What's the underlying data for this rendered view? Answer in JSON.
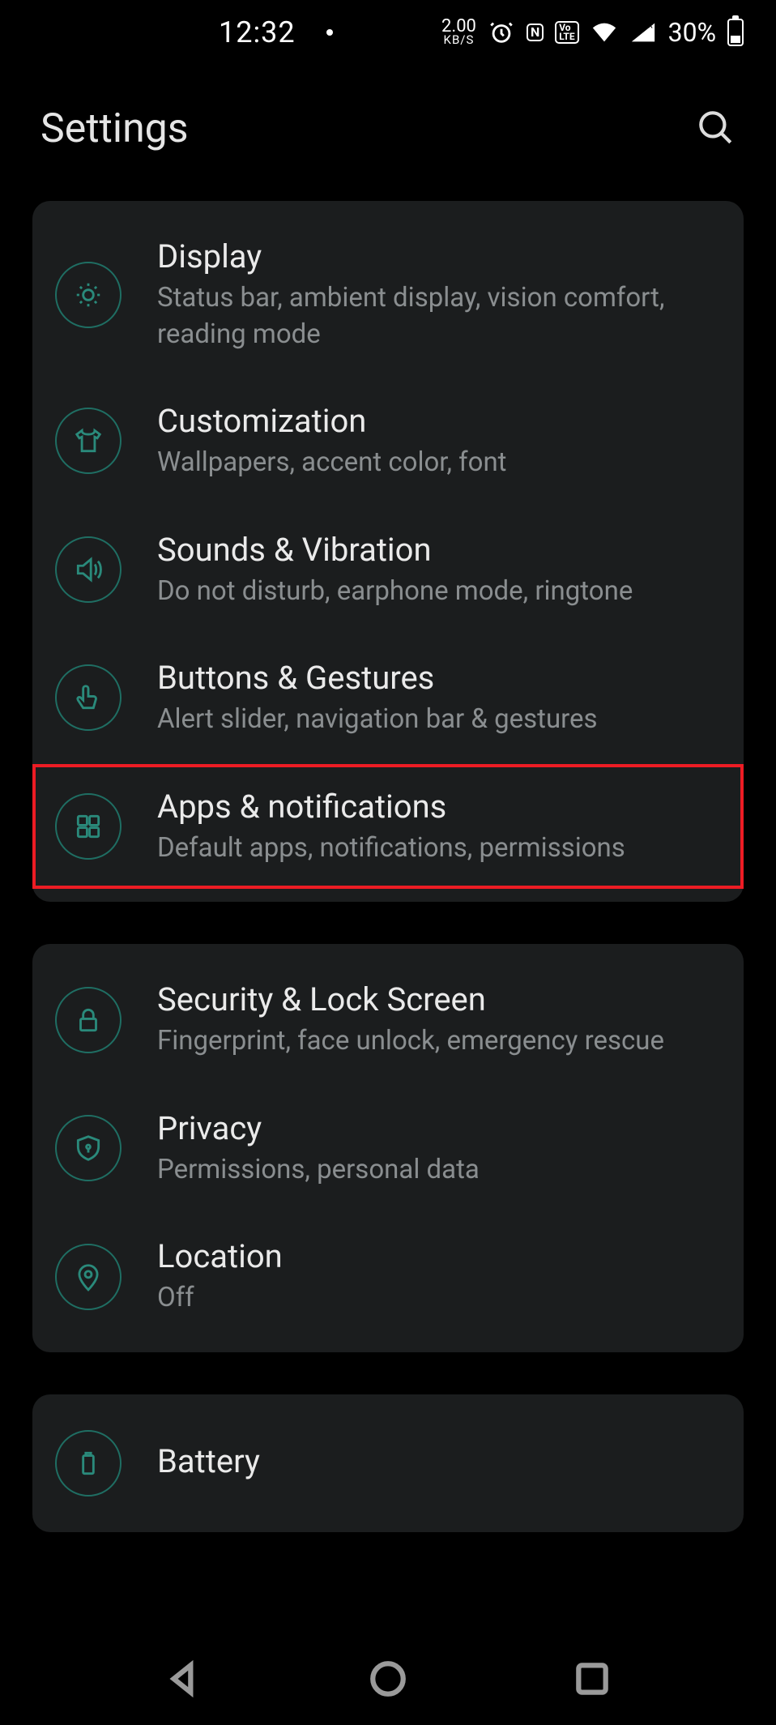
{
  "status": {
    "time": "12:32",
    "speed_top": "2.00",
    "speed_bot": "KB/S",
    "nfc": "N",
    "volte": "Vo LTE",
    "battery_pct": "30%"
  },
  "header": {
    "title": "Settings"
  },
  "groups": [
    {
      "items": [
        {
          "key": "display",
          "title": "Display",
          "sub": "Status bar, ambient display, vision comfort, reading mode",
          "icon": "brightness-icon",
          "highlighted": false
        },
        {
          "key": "customization",
          "title": "Customization",
          "sub": "Wallpapers, accent color, font",
          "icon": "tshirt-icon",
          "highlighted": false
        },
        {
          "key": "sounds",
          "title": "Sounds & Vibration",
          "sub": "Do not disturb, earphone mode, ringtone",
          "icon": "speaker-icon",
          "highlighted": false
        },
        {
          "key": "buttons",
          "title": "Buttons & Gestures",
          "sub": "Alert slider, navigation bar & gestures",
          "icon": "gesture-icon",
          "highlighted": false
        },
        {
          "key": "apps",
          "title": "Apps & notifications",
          "sub": "Default apps, notifications, permissions",
          "icon": "apps-icon",
          "highlighted": true
        }
      ]
    },
    {
      "items": [
        {
          "key": "security",
          "title": "Security & Lock Screen",
          "sub": "Fingerprint, face unlock, emergency rescue",
          "icon": "lock-icon",
          "highlighted": false
        },
        {
          "key": "privacy",
          "title": "Privacy",
          "sub": "Permissions, personal data",
          "icon": "shield-icon",
          "highlighted": false
        },
        {
          "key": "location",
          "title": "Location",
          "sub": "Off",
          "icon": "pin-icon",
          "highlighted": false
        }
      ]
    },
    {
      "items": [
        {
          "key": "battery",
          "title": "Battery",
          "sub": "",
          "icon": "battery-icon",
          "highlighted": false
        }
      ]
    }
  ]
}
